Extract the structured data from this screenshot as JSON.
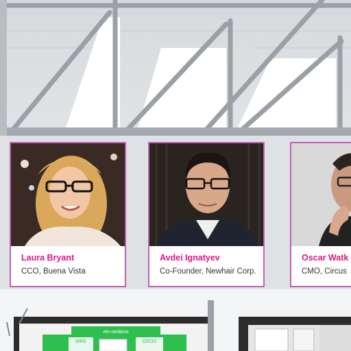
{
  "speakers": [
    {
      "name": "Laura Bryant",
      "role": "CCO, Buena Vista"
    },
    {
      "name": "Avdei Ignatyev",
      "role": "Co-Founder, Newhair Corp."
    },
    {
      "name": "Oscar Watk",
      "role": "CMO, Circus"
    }
  ],
  "booth": {
    "logo_text": "elo-cerdono",
    "panel_left": "WKE",
    "panel_right": "GEOS"
  },
  "colors": {
    "accent_pink": "#e0157f",
    "card_border": "#c45fb6",
    "booth_green": "#2fbf4e"
  }
}
